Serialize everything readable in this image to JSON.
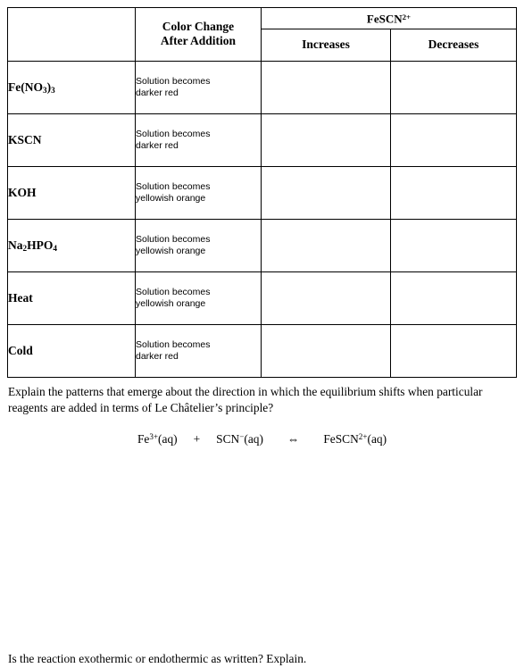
{
  "table": {
    "header": {
      "corner_label": "",
      "color_change_line1": "Color Change",
      "color_change_line2": "After Addition",
      "product_label_text": "FeSCN",
      "product_label_sup": "2+",
      "increases": "Increases",
      "decreases": "Decreases"
    },
    "rows": [
      {
        "reagent_html": "Fe(NO<sub>3</sub>)<sub>3</sub>",
        "reagent_plain": "Fe(NO3)3",
        "effect_line1": "Solution becomes",
        "effect_line2": "darker red",
        "increases_mark": "",
        "decreases_mark": ""
      },
      {
        "reagent_html": "KSCN",
        "reagent_plain": "KSCN",
        "effect_line1": "Solution becomes",
        "effect_line2": "darker red",
        "increases_mark": "",
        "decreases_mark": ""
      },
      {
        "reagent_html": "KOH",
        "reagent_plain": "KOH",
        "effect_line1": "Solution becomes",
        "effect_line2": "yellowish orange",
        "increases_mark": "",
        "decreases_mark": ""
      },
      {
        "reagent_html": "Na<sub>2</sub>HPO<sub>4</sub>",
        "reagent_plain": "Na2HPO4",
        "effect_line1": "Solution becomes",
        "effect_line2": "yellowish orange",
        "increases_mark": "",
        "decreases_mark": ""
      },
      {
        "reagent_html": "Heat",
        "reagent_plain": "Heat",
        "effect_line1": "Solution becomes",
        "effect_line2": "yellowish orange",
        "increases_mark": "",
        "decreases_mark": ""
      },
      {
        "reagent_html": "Cold",
        "reagent_plain": "Cold",
        "effect_line1": "Solution becomes",
        "effect_line2": "darker red",
        "increases_mark": "",
        "decreases_mark": ""
      }
    ]
  },
  "questions": {
    "patterns": "Explain the patterns that emerge about the direction in which the equilibrium shifts when particular reagents are added in terms of Le Châtelier’s principle?",
    "thermo": "Is the reaction exothermic or endothermic as written?  Explain."
  },
  "equation": {
    "reactant1_symbol": "Fe",
    "reactant1_charge": "3+",
    "reactant1_state": "(aq)",
    "plus": "+",
    "reactant2_symbol": "SCN",
    "reactant2_charge": "−",
    "reactant2_state": "(aq)",
    "arrow": "⇔",
    "product_symbol": "FeSCN",
    "product_charge": "2+",
    "product_state": "(aq)",
    "plain_text": "Fe3+(aq) + SCN-(aq) ⇔ FeSCN2+(aq)"
  },
  "colors": {
    "page_background": "#ffffff",
    "text": "#000000",
    "table_border": "#000000"
  }
}
